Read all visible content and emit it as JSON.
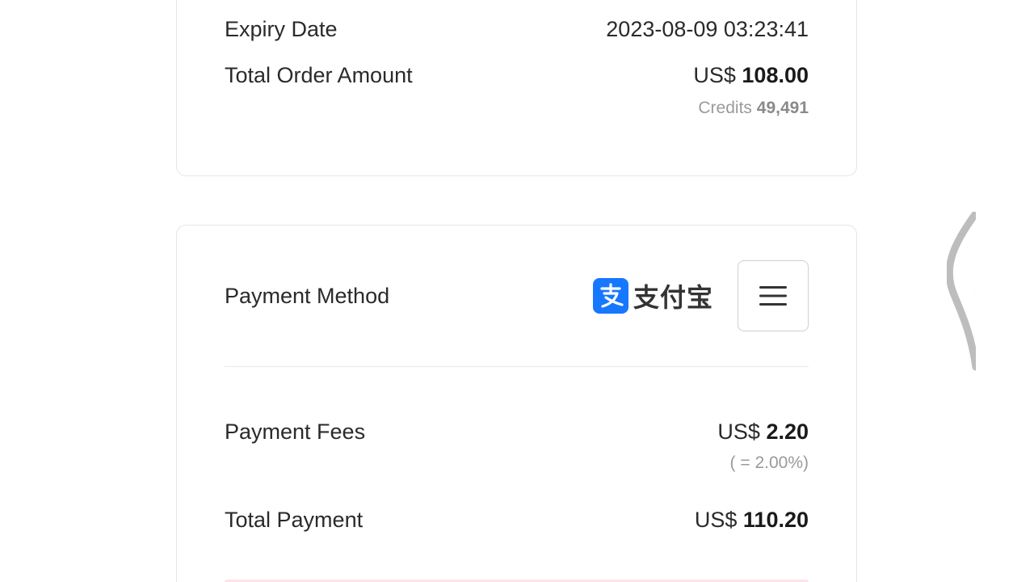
{
  "order": {
    "expiry_label": "Expiry Date",
    "expiry_value": "2023-08-09 03:23:41",
    "total_label": "Total Order Amount",
    "total_currency": "US$",
    "total_amount": "108.00",
    "credits_label": "Credits",
    "credits_value": "49,491"
  },
  "payment": {
    "method_label": "Payment Method",
    "method_brand_text": "支付宝",
    "method_icon": "alipay-icon",
    "menu_icon": "hamburger-menu-icon",
    "fees_label": "Payment Fees",
    "fees_currency": "US$",
    "fees_amount": "2.20",
    "fees_rate": "( = 2.00%)",
    "total_label": "Total Payment",
    "total_currency": "US$",
    "total_amount": "110.20"
  },
  "colors": {
    "alipay_blue": "#1677ff",
    "accent_pink": "#fde4ea"
  }
}
